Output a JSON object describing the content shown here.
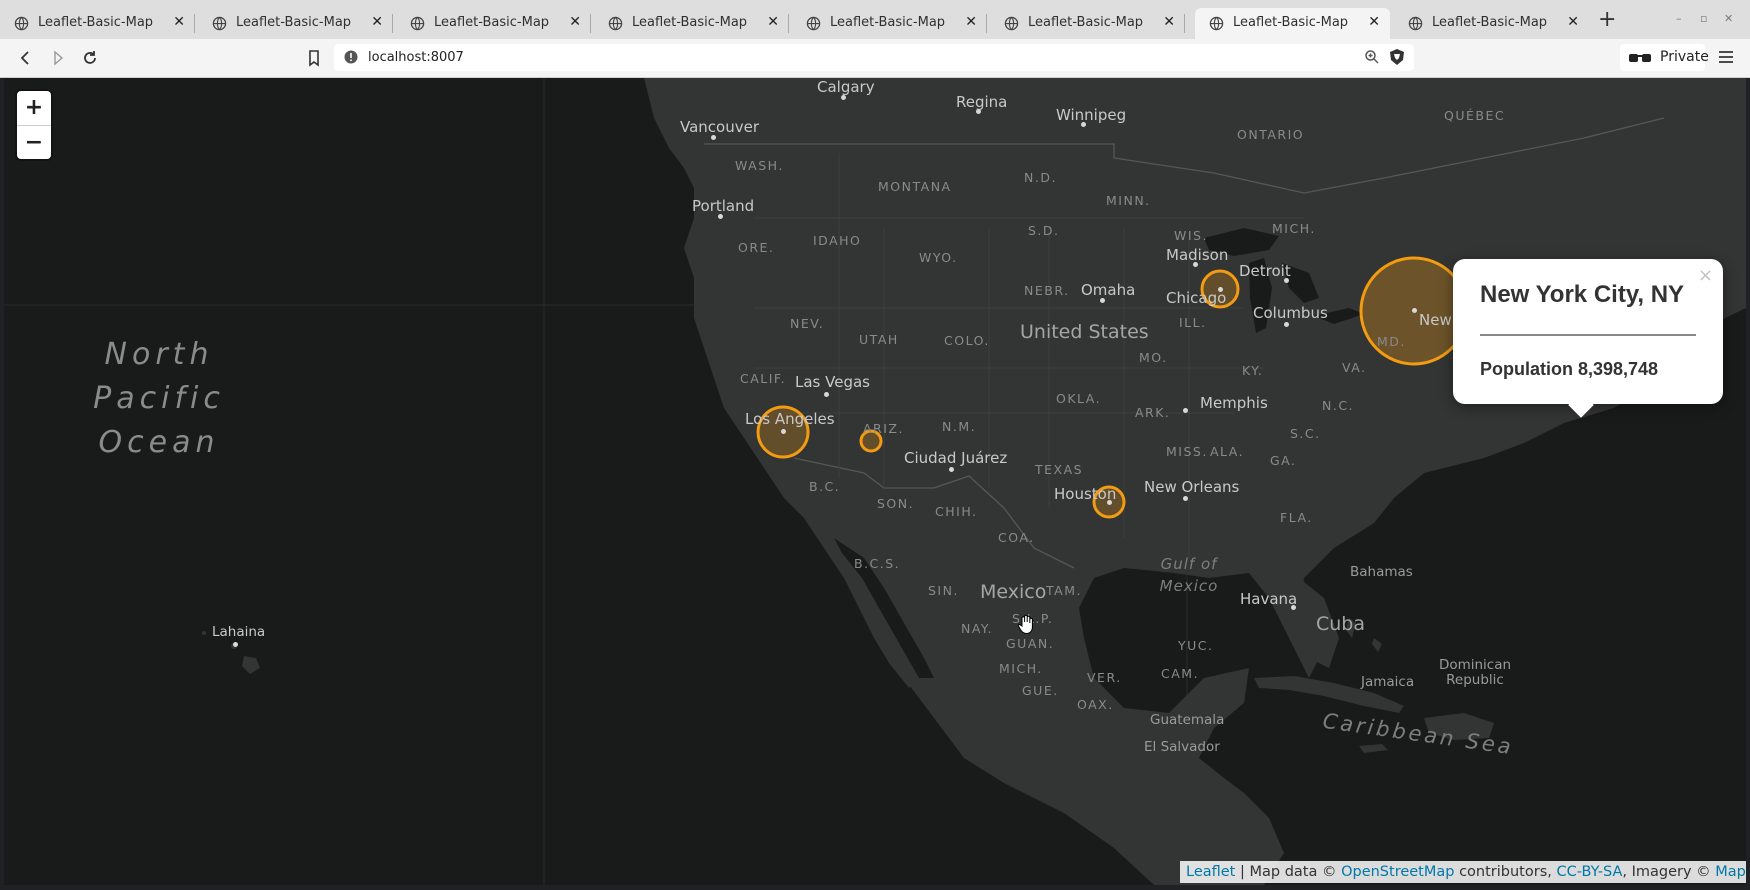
{
  "browser": {
    "tabs": [
      {
        "title": "Leaflet-Basic-Map",
        "active": false
      },
      {
        "title": "Leaflet-Basic-Map",
        "active": false
      },
      {
        "title": "Leaflet-Basic-Map",
        "active": false
      },
      {
        "title": "Leaflet-Basic-Map",
        "active": false
      },
      {
        "title": "Leaflet-Basic-Map",
        "active": false
      },
      {
        "title": "Leaflet-Basic-Map",
        "active": false
      },
      {
        "title": "Leaflet-Basic-Map",
        "active": true
      },
      {
        "title": "Leaflet-Basic-Map",
        "active": false
      }
    ],
    "new_tab_label": "+",
    "url": "localhost:8007",
    "private_label": "Private",
    "icons": {
      "back": "back-arrow-icon",
      "forward": "forward-arrow-icon",
      "reload": "reload-icon",
      "bookmark": "bookmark-icon",
      "site_info": "info-icon",
      "zoom": "zoom-icon",
      "shields": "brave-shield-icon",
      "private": "private-glasses-icon",
      "menu": "hamburger-menu-icon"
    }
  },
  "map": {
    "zoom_in_label": "+",
    "zoom_out_label": "−",
    "ocean_label": "North Pacific Ocean",
    "gulf_label": "Gulf of Mexico",
    "sea_label": "Caribbean Sea",
    "country_labels": [
      "United States",
      "Mexico",
      "Cuba"
    ],
    "cities": [
      "Calgary",
      "Regina",
      "Winnipeg",
      "Vancouver",
      "Portland",
      "Madison",
      "Detroit",
      "Chicago",
      "Omaha",
      "Columbus",
      "Las Vegas",
      "Los Angeles",
      "Memphis",
      "Ciudad Juárez",
      "Houston",
      "New Orleans",
      "New York",
      "Havana",
      "Bahamas",
      "Jamaica",
      "Dominican Republic",
      "Guatemala",
      "El Salvador",
      "Lahaina"
    ],
    "region_labels": [
      "WASH.",
      "MONTANA",
      "N.D.",
      "MINN.",
      "ONTARIO",
      "QUÉBEC",
      "ORE.",
      "IDAHO",
      "WYO.",
      "S.D.",
      "WIS.",
      "MICH.",
      "NEBR.",
      "NEV.",
      "UTAH",
      "COLO.",
      "ILL.",
      "MO.",
      "KY.",
      "VA.",
      "CALIF.",
      "ARIZ.",
      "N.M.",
      "OKLA.",
      "ARK.",
      "N.C.",
      "S.C.",
      "TEXAS",
      "MISS.",
      "ALA.",
      "GA.",
      "B.C.",
      "SON.",
      "CHIH.",
      "COA.",
      "FLA.",
      "B.C.S.",
      "SIN.",
      "TAM.",
      "S.L.P.",
      "NAY.",
      "GUAN.",
      "MICH.",
      "GUE.",
      "VER.",
      "OAX.",
      "YUC.",
      "CAM.",
      "MD."
    ],
    "marker_color": "#f39c12",
    "popup": {
      "title": "New York City, NY",
      "population_text": "Population 8,398,748",
      "close_label": "×"
    },
    "attribution": {
      "leaflet": "Leaflet",
      "sep": " | Map data © ",
      "osm": "OpenStreetMap",
      "contrib": " contributors, ",
      "license": "CC-BY-SA",
      "imagery": ", Imagery © ",
      "mapbox": "Mapbox"
    }
  }
}
